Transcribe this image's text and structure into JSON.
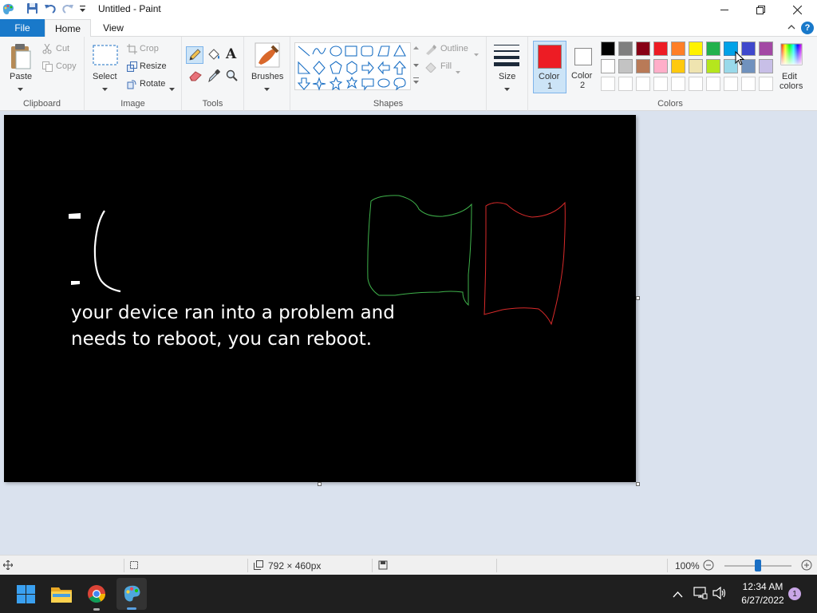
{
  "window": {
    "title": "Untitled - Paint"
  },
  "menu": {
    "file": "File",
    "home": "Home",
    "view": "View",
    "help": "?"
  },
  "clipboard": {
    "label": "Clipboard",
    "paste": "Paste",
    "cut": "Cut",
    "copy": "Copy"
  },
  "image": {
    "label": "Image",
    "select": "Select",
    "crop": "Crop",
    "resize": "Resize",
    "rotate": "Rotate"
  },
  "tools": {
    "label": "Tools",
    "text_tool": "A"
  },
  "brushes": {
    "label": "Brushes"
  },
  "shapes": {
    "label": "Shapes",
    "outline": "Outline",
    "fill": "Fill"
  },
  "size": {
    "label": "Size"
  },
  "colors": {
    "label": "Colors",
    "color1_label_1": "Color",
    "color1_label_2": "1",
    "color2_label_1": "Color",
    "color2_label_2": "2",
    "edit_label_1": "Edit",
    "edit_label_2": "colors",
    "color1": "#ed1c24",
    "color2": "#ffffff",
    "palette_row1": [
      "#000000",
      "#7f7f7f",
      "#880015",
      "#ed1c24",
      "#ff7f27",
      "#fff200",
      "#22b14c",
      "#00a2e8",
      "#3f48cc",
      "#a349a4"
    ],
    "palette_row2": [
      "#ffffff",
      "#c3c3c3",
      "#b97a57",
      "#ffaec9",
      "#ffc90e",
      "#efe4b0",
      "#b5e61d",
      "#99d9ea",
      "#7092be",
      "#c8bfe7"
    ]
  },
  "canvas": {
    "text_line1": "your device ran into a problem and",
    "text_line2": "needs to reboot, you can reboot."
  },
  "status": {
    "dimensions": "792 × 460px",
    "zoom": "100%",
    "zoom_fraction": 0.5
  },
  "taskbar": {
    "time": "12:34 AM",
    "date": "6/27/2022",
    "notification_count": "1"
  }
}
